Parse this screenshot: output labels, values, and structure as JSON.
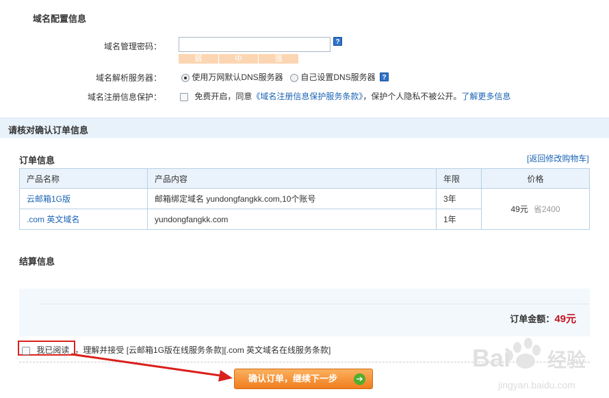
{
  "domain_config": {
    "title": "域名配置信息",
    "password_label": "域名管理密码：",
    "password_value": "",
    "strength": [
      "弱",
      "中",
      "强"
    ],
    "dns_label": "域名解析服务器：",
    "dns_options": [
      "使用万网默认DNS服务器",
      "自己设置DNS服务器"
    ],
    "privacy_label": "域名注册信息保护：",
    "privacy_text_1": "免费开启，同意",
    "privacy_link": "《域名注册信息保护服务条款》",
    "privacy_text_2": "，保护个人隐私不被公开。",
    "privacy_more": "了解更多信息"
  },
  "confirm_title": "请核对确认订单信息",
  "order": {
    "title": "订单信息",
    "back_link": "[返回修改购物车]",
    "headers": [
      "产品名称",
      "产品内容",
      "年限",
      "价格"
    ],
    "rows": [
      {
        "name": "云邮箱1G版",
        "content": "邮箱绑定域名 yundongfangkk.com,10个账号",
        "years": "3年"
      },
      {
        "name": ".com 英文域名",
        "content": "yundongfangkk.com",
        "years": "1年"
      }
    ],
    "price": "49元",
    "saved": "省2400"
  },
  "settlement": {
    "title": "结算信息",
    "total_label": "订单金额：",
    "total_value": "49元"
  },
  "agreement": {
    "checkbox_label": "我已阅读",
    "text": "，理解并接受 [云邮箱1G版在线服务条款]",
    "text2": "[.com 英文域名在线服务条款]"
  },
  "submit_button": "确认订单，继续下一步",
  "watermark": {
    "brand": "Bai 经验",
    "url": "jingyan.baidu.com"
  },
  "colors": {
    "accent": "#1b63b4",
    "button": "#f07d1e",
    "price_red": "#c1121f"
  }
}
